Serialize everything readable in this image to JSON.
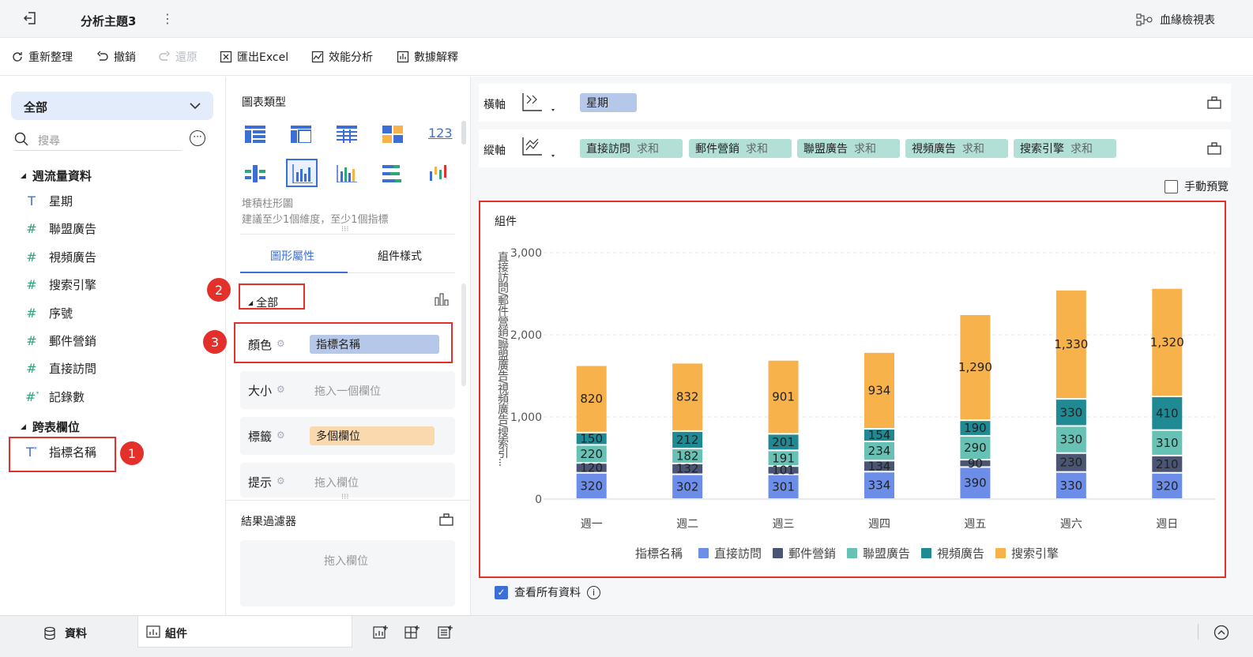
{
  "header": {
    "title": "分析主題3",
    "lineage_label": "血緣檢視表"
  },
  "toolbar": {
    "refresh": "重新整理",
    "undo": "撤銷",
    "redo": "還原",
    "export": "匯出Excel",
    "perf": "效能分析",
    "explain": "數據解釋"
  },
  "left": {
    "selector": "全部",
    "search_placeholder": "搜尋",
    "group1": "週流量資料",
    "fields": [
      {
        "icon": "T",
        "label": "星期"
      },
      {
        "icon": "#",
        "label": "聯盟廣告"
      },
      {
        "icon": "#",
        "label": "視頻廣告"
      },
      {
        "icon": "#",
        "label": "搜索引擎"
      },
      {
        "icon": "#",
        "label": "序號"
      },
      {
        "icon": "#",
        "label": "郵件營銷"
      },
      {
        "icon": "#",
        "label": "直接訪問"
      },
      {
        "icon": "#*",
        "label": "記錄數"
      }
    ],
    "group2": "跨表欄位",
    "cross_field": "指標名稱"
  },
  "mid": {
    "chart_type_title": "圖表類型",
    "chart_name": "堆積柱形圖",
    "chart_hint": "建議至少1個維度，至少1個指標",
    "tab_graph": "圖形屬性",
    "tab_style": "組件樣式",
    "all_label": "全部",
    "color_label": "顏色",
    "color_value": "指標名稱",
    "size_label": "大小",
    "size_ph": "拖入一個欄位",
    "label_label": "標籤",
    "label_value": "多個欄位",
    "tip_label": "提示",
    "tip_ph": "拖入欄位",
    "filter_title": "結果過濾器",
    "filter_ph": "拖入欄位"
  },
  "right": {
    "x_axis_label": "橫軸",
    "x_chip": "星期",
    "y_axis_label": "縱軸",
    "y_chips": [
      {
        "name": "直接訪問",
        "agg": "求和"
      },
      {
        "name": "郵件營銷",
        "agg": "求和"
      },
      {
        "name": "聯盟廣告",
        "agg": "求和"
      },
      {
        "name": "視頻廣告",
        "agg": "求和"
      },
      {
        "name": "搜索引擎",
        "agg": "求和"
      }
    ],
    "manual_preview": "手動預覽",
    "component_title": "組件",
    "view_all": "查看所有資料"
  },
  "badges": [
    "1",
    "2",
    "3"
  ],
  "bottom": {
    "data_tab": "資料",
    "component_tab": "組件"
  },
  "colors": {
    "direct": "#6c8ee8",
    "email": "#4a5573",
    "alliance": "#67c1b5",
    "video": "#1f8a94",
    "search": "#f7b24c",
    "highlight": "#e4302b",
    "accent": "#3b6fd6"
  },
  "chart_data": {
    "type": "bar",
    "stacked": true,
    "categories": [
      "週一",
      "週二",
      "週三",
      "週四",
      "週五",
      "週六",
      "週日"
    ],
    "series": [
      {
        "name": "直接訪問",
        "values": [
          320,
          302,
          301,
          334,
          390,
          330,
          320
        ]
      },
      {
        "name": "郵件營銷",
        "values": [
          120,
          132,
          101,
          134,
          90,
          230,
          210
        ]
      },
      {
        "name": "聯盟廣告",
        "values": [
          220,
          182,
          191,
          234,
          290,
          330,
          310
        ]
      },
      {
        "name": "視頻廣告",
        "values": [
          150,
          212,
          201,
          154,
          190,
          330,
          410
        ]
      },
      {
        "name": "搜索引擎",
        "values": [
          820,
          832,
          901,
          934,
          1290,
          1330,
          1320
        ]
      }
    ],
    "ylabel": "直接訪問/郵件營銷/聯盟廣告/視頻廣告/搜索引...",
    "y_ticks": [
      "0",
      "1,000",
      "2,000",
      "3,000"
    ],
    "ylim": [
      0,
      3000
    ],
    "legend_title": "指標名稱",
    "legend_position": "bottom",
    "grid": true
  }
}
